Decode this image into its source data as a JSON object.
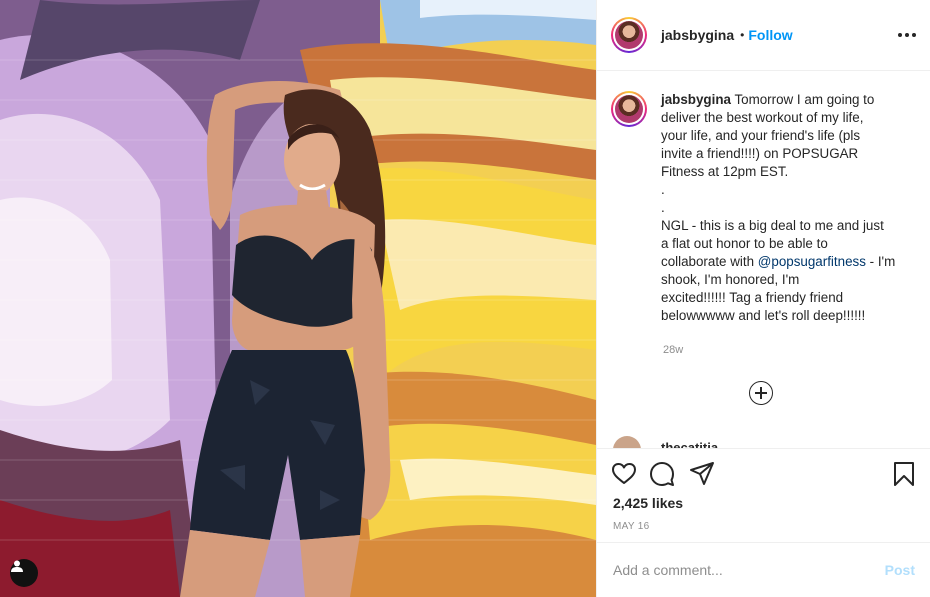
{
  "post": {
    "username": "jabsbygina",
    "dot": "•",
    "follow_label": "Follow",
    "caption_username": "jabsbygina",
    "caption_lines": [
      "Tomorrow I am going to",
      "deliver the best workout of my life,",
      "your life, and your friend's life (pls",
      "invite a friend!!!!) on POPSUGAR",
      "Fitness at 12pm EST.",
      ".",
      ".",
      "NGL - this is a big deal to me and just",
      "a flat out honor to be able to",
      "collaborate with",
      "- I'm shook, I'm honored, I'm",
      "excited!!!!!! Tag a friendy friend",
      "belowwwww and let's roll deep!!!!!!"
    ],
    "mention": "@popsugarfitness",
    "age": "28w",
    "peek_comment_user": "thecatitia",
    "likes": "2,425 likes",
    "date": "MAY 16",
    "comment_placeholder": "Add a comment...",
    "post_label": "Post"
  },
  "icons": {
    "more": "more-options-icon",
    "plus": "load-more-comments-icon",
    "like": "heart-icon",
    "comment": "comment-icon",
    "share": "paper-plane-icon",
    "save": "bookmark-icon",
    "tags": "user-tag-icon"
  },
  "colors": {
    "accent": "#0095f6",
    "post_disabled": "#b2dffc",
    "mention": "#00376b"
  }
}
